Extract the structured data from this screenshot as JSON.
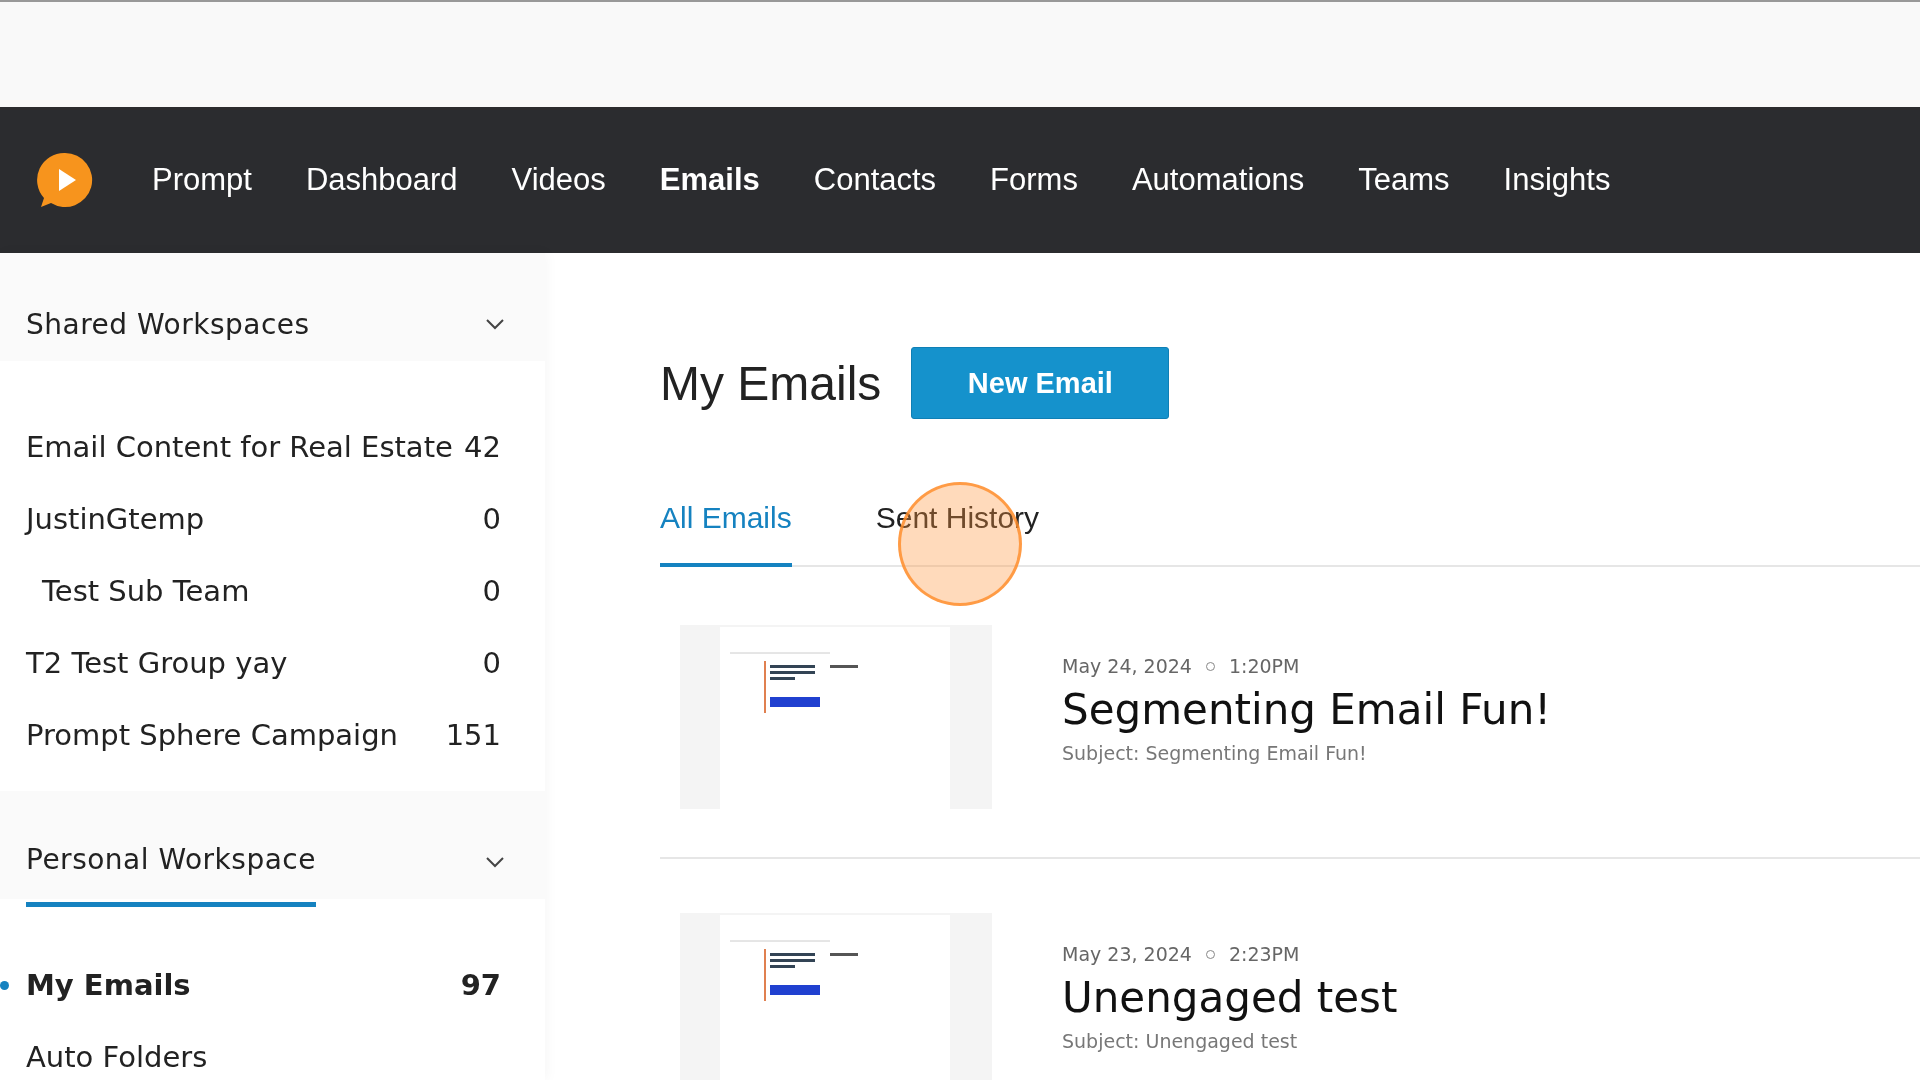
{
  "nav": {
    "items": [
      {
        "label": "Prompt",
        "selected": false
      },
      {
        "label": "Dashboard",
        "selected": false
      },
      {
        "label": "Videos",
        "selected": false
      },
      {
        "label": "Emails",
        "selected": true
      },
      {
        "label": "Contacts",
        "selected": false
      },
      {
        "label": "Forms",
        "selected": false
      },
      {
        "label": "Automations",
        "selected": false
      },
      {
        "label": "Teams",
        "selected": false
      },
      {
        "label": "Insights",
        "selected": false
      }
    ]
  },
  "sidebar": {
    "sections": [
      {
        "title": "Shared Workspaces",
        "expanded": true,
        "selected": false,
        "items": [
          {
            "label": "Email Content for Real Estate",
            "count": "42",
            "selected": false
          },
          {
            "label": "JustinGtemp",
            "count": "0",
            "selected": false,
            "children": [
              {
                "label": "Test Sub Team",
                "count": "0",
                "selected": false
              }
            ]
          },
          {
            "label": "T2 Test Group yay",
            "count": "0",
            "selected": false
          },
          {
            "label": "Prompt Sphere Campaign",
            "count": "151",
            "selected": false
          }
        ]
      },
      {
        "title": "Personal Workspace",
        "expanded": true,
        "selected": true,
        "items": [
          {
            "label": "My Emails",
            "count": "97",
            "selected": true
          },
          {
            "label": "Auto Folders",
            "selected": false
          }
        ]
      }
    ]
  },
  "main": {
    "title": "My Emails",
    "new_button": "New Email",
    "tabs": [
      {
        "label": "All Emails",
        "selected": true
      },
      {
        "label": "Sent History",
        "selected": false
      }
    ],
    "emails": [
      {
        "date": "May 24, 2024",
        "time": "1:20PM",
        "title": "Segmenting Email Fun!",
        "subject": "Subject: Segmenting Email Fun!"
      },
      {
        "date": "May 23, 2024",
        "time": "2:23PM",
        "title": "Unengaged test",
        "subject": "Subject: Unengaged test"
      }
    ]
  }
}
